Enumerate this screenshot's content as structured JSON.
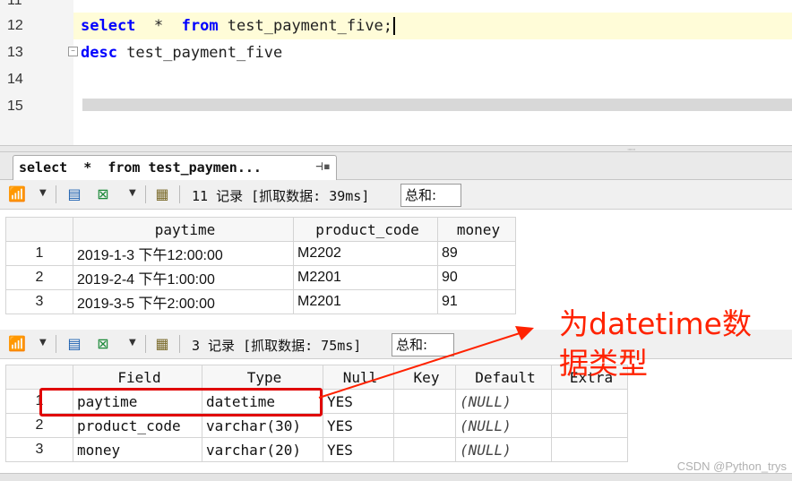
{
  "editor": {
    "lines": [
      {
        "num": "11"
      },
      {
        "num": "12",
        "kw1": "select",
        "mid": "  *  ",
        "kw2": "from",
        "rest": " test_payment_five;"
      },
      {
        "num": "13",
        "kw1": "desc",
        "rest": " test_payment_five"
      },
      {
        "num": "14"
      },
      {
        "num": "15"
      }
    ]
  },
  "result_tab": {
    "label": "select  *  from test_paymen...",
    "pin_icon": "pin-icon"
  },
  "toolbar1": {
    "record_text": "11 记录 [抓取数据: 39ms]",
    "sum_label": "总和:"
  },
  "table1": {
    "columns": [
      "paytime",
      "product_code",
      "money"
    ],
    "rows": [
      {
        "n": "1",
        "cells": [
          "2019-1-3 下午12:00:00",
          "M2202",
          "89"
        ]
      },
      {
        "n": "2",
        "cells": [
          "2019-2-4 下午1:00:00",
          "M2201",
          "90"
        ]
      },
      {
        "n": "3",
        "cells": [
          "2019-3-5 下午2:00:00",
          "M2201",
          "91"
        ]
      }
    ]
  },
  "toolbar2": {
    "record_text": "3 记录 [抓取数据: 75ms]",
    "sum_label": "总和:"
  },
  "table2": {
    "columns": [
      "Field",
      "Type",
      "Null",
      "Key",
      "Default",
      "Extra"
    ],
    "rows": [
      {
        "n": "1",
        "cells": [
          "paytime",
          "datetime",
          "YES",
          "",
          "(NULL)",
          ""
        ]
      },
      {
        "n": "2",
        "cells": [
          "product_code",
          "varchar(30)",
          "YES",
          "",
          "(NULL)",
          ""
        ]
      },
      {
        "n": "3",
        "cells": [
          "money",
          "varchar(20)",
          "YES",
          "",
          "(NULL)",
          ""
        ]
      }
    ]
  },
  "annotation": {
    "line1": "为datetime数",
    "line2": "据类型",
    "color": "#ff2200"
  },
  "watermark": "CSDN @Python_trys",
  "colors": {
    "keyword": "#0000ff",
    "current_line": "#fffcd8",
    "highlight_box": "#e00000"
  }
}
